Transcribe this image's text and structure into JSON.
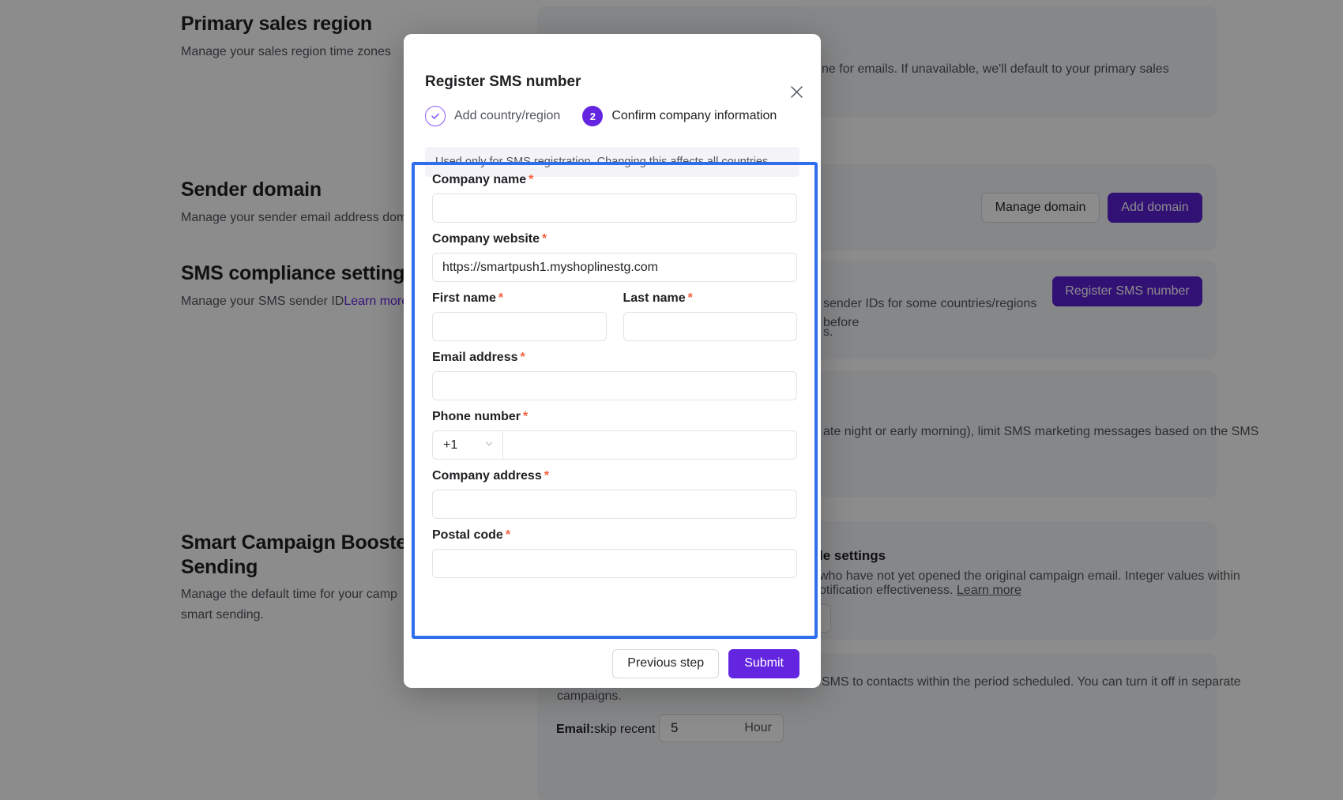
{
  "background": {
    "sections": [
      {
        "title": "Primary sales region",
        "subtitle": "Manage your sales region time zones"
      },
      {
        "title": "Sender domain",
        "subtitle": "Manage your sender email address dom"
      },
      {
        "title": "SMS compliance settings",
        "subtitle_prefix": "Manage your SMS sender ID",
        "subtitle_link": "Learn more"
      },
      {
        "title_line1": "Smart Campaign Booster &",
        "title_line2": "Sending",
        "subtitle_line1": "Manage the default time for your camp",
        "subtitle_line2": "smart sending."
      }
    ],
    "fragments": {
      "primary_region_card_text": "ne for emails. If unavailable, we'll default to your primary sales",
      "sms_compliance_card_text_line1": "sender IDs for some countries/regions before",
      "sms_compliance_card_text_line2": "s.",
      "quiet_hours_text": "ate night or early morning), limit SMS marketing messages based on the SMS",
      "resend_card_title": "le settings",
      "resend_card_line1": "who have not yet opened the original campaign email. Integer values within",
      "resend_card_line2": "otification effectiveness.",
      "resend_card_link": "Learn more",
      "smart_sending_line1": "SMS to contacts within the period scheduled. You can turn it off in separate",
      "smart_sending_line2": "campaigns."
    },
    "buttons": {
      "manage_domain": "Manage domain",
      "add_domain": "Add domain",
      "register_sms_number": "Register SMS number"
    },
    "smart_sending_row": {
      "label": "Email:",
      "sub_label": "skip recent",
      "value": "5",
      "unit": "Hour"
    },
    "colors": {
      "primary": "#5c1fd6",
      "link": "#6425e0",
      "focus_outline": "#2f6fed",
      "required": "#f4603e"
    }
  },
  "modal": {
    "title": "Register SMS number",
    "close_icon": "close-icon",
    "steps": [
      {
        "id": "1",
        "glyph": "check-icon",
        "label": "Add country/region",
        "state": "done"
      },
      {
        "id": "2",
        "glyph": "2",
        "label": "Confirm company information",
        "state": "active"
      }
    ],
    "notice": "Used only for SMS registration. Changing this affects all countries.",
    "fields": {
      "company_name": {
        "label": "Company name",
        "required": "*",
        "value": "",
        "placeholder": ""
      },
      "company_website": {
        "label": "Company website",
        "required": "*",
        "value": "https://smartpush1.myshoplinestg.com",
        "placeholder": ""
      },
      "first_name": {
        "label": "First name",
        "required": "*",
        "value": "",
        "placeholder": ""
      },
      "last_name": {
        "label": "Last name",
        "required": "*",
        "value": "",
        "placeholder": ""
      },
      "email_address": {
        "label": "Email address",
        "required": "*",
        "value": "",
        "placeholder": ""
      },
      "phone_number": {
        "label": "Phone number",
        "required": "*",
        "country_code": "+1",
        "value": "",
        "placeholder": ""
      },
      "company_address": {
        "label": "Company address",
        "required": "*",
        "value": "",
        "placeholder": ""
      },
      "postal_code": {
        "label": "Postal code",
        "required": "*",
        "value": "",
        "placeholder": ""
      }
    },
    "footer": {
      "previous": "Previous step",
      "submit": "Submit"
    }
  }
}
